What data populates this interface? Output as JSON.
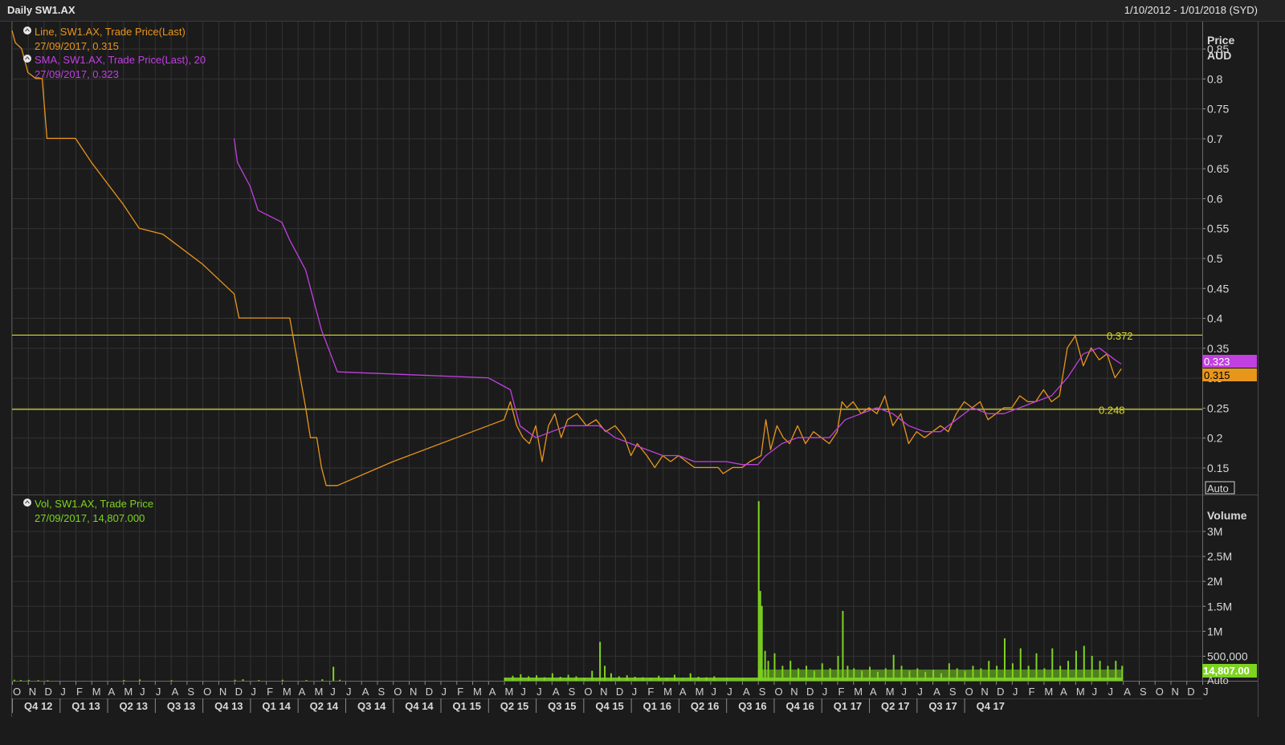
{
  "header": {
    "title": "Daily SW1.AX",
    "range": "1/10/2012 - 1/01/2018 (SYD)"
  },
  "colors": {
    "price": "#e8951c",
    "sma": "#c040e0",
    "volume": "#7ed321",
    "hline": "#d9d92a",
    "grid": "#333333",
    "text": "#d8d8d8",
    "bg": "#1b1b1b"
  },
  "chart_data": [
    {
      "type": "line",
      "panel": "price",
      "legend": [
        {
          "title": "Line, SW1.AX, Trade Price(Last)",
          "value": "27/09/2017, 0.315"
        },
        {
          "title": "SMA, SW1.AX, Trade Price(Last),  20",
          "value": "27/09/2017, 0.323"
        }
      ],
      "axis_title": [
        "Price",
        "AUD"
      ],
      "yticks": [
        "0.15",
        "0.2",
        "0.25",
        "0.3",
        "0.35",
        "0.4",
        "0.45",
        "0.5",
        "0.55",
        "0.6",
        "0.65",
        "0.7",
        "0.75",
        "0.8",
        "0.85"
      ],
      "ylim": [
        0.105,
        0.895
      ],
      "x_range_months": [
        0,
        75
      ],
      "series": [
        {
          "name": "Line, SW1.AX, Trade Price(Last)",
          "points": [
            [
              0,
              0.88
            ],
            [
              0.2,
              0.86
            ],
            [
              0.6,
              0.85
            ],
            [
              1.0,
              0.81
            ],
            [
              1.5,
              0.8
            ],
            [
              1.9,
              0.8
            ],
            [
              2.2,
              0.7
            ],
            [
              4.0,
              0.7
            ],
            [
              5.0,
              0.66
            ],
            [
              7.0,
              0.59
            ],
            [
              8.0,
              0.55
            ],
            [
              9.5,
              0.54
            ],
            [
              12.0,
              0.49
            ],
            [
              14.0,
              0.44
            ],
            [
              14.3,
              0.4
            ],
            [
              17.5,
              0.4
            ],
            [
              18.5,
              0.25
            ],
            [
              18.8,
              0.2
            ],
            [
              19.2,
              0.2
            ],
            [
              19.5,
              0.15
            ],
            [
              19.8,
              0.12
            ],
            [
              20.5,
              0.12
            ],
            [
              24.0,
              0.16
            ],
            [
              28.0,
              0.2
            ],
            [
              31.0,
              0.23
            ],
            [
              31.4,
              0.26
            ],
            [
              31.8,
              0.22
            ],
            [
              32.2,
              0.2
            ],
            [
              32.6,
              0.19
            ],
            [
              33.0,
              0.22
            ],
            [
              33.4,
              0.16
            ],
            [
              33.8,
              0.22
            ],
            [
              34.2,
              0.24
            ],
            [
              34.6,
              0.2
            ],
            [
              35.0,
              0.23
            ],
            [
              35.6,
              0.24
            ],
            [
              36.2,
              0.22
            ],
            [
              36.8,
              0.23
            ],
            [
              37.4,
              0.21
            ],
            [
              38.0,
              0.22
            ],
            [
              38.6,
              0.2
            ],
            [
              39.0,
              0.17
            ],
            [
              39.4,
              0.19
            ],
            [
              40.0,
              0.17
            ],
            [
              40.5,
              0.15
            ],
            [
              41.0,
              0.17
            ],
            [
              41.5,
              0.16
            ],
            [
              42.0,
              0.17
            ],
            [
              42.5,
              0.16
            ],
            [
              43.0,
              0.15
            ],
            [
              43.5,
              0.15
            ],
            [
              44.0,
              0.15
            ],
            [
              44.5,
              0.15
            ],
            [
              44.8,
              0.14
            ],
            [
              45.4,
              0.15
            ],
            [
              46.0,
              0.15
            ],
            [
              46.5,
              0.16
            ],
            [
              47.2,
              0.17
            ],
            [
              47.5,
              0.23
            ],
            [
              47.8,
              0.18
            ],
            [
              48.2,
              0.22
            ],
            [
              48.6,
              0.2
            ],
            [
              49.0,
              0.19
            ],
            [
              49.5,
              0.22
            ],
            [
              50.0,
              0.19
            ],
            [
              50.5,
              0.21
            ],
            [
              51.0,
              0.2
            ],
            [
              51.5,
              0.19
            ],
            [
              52.0,
              0.21
            ],
            [
              52.3,
              0.26
            ],
            [
              52.6,
              0.25
            ],
            [
              53.0,
              0.26
            ],
            [
              53.5,
              0.24
            ],
            [
              54.0,
              0.25
            ],
            [
              54.5,
              0.24
            ],
            [
              55.0,
              0.27
            ],
            [
              55.5,
              0.22
            ],
            [
              56.0,
              0.24
            ],
            [
              56.5,
              0.19
            ],
            [
              57.0,
              0.21
            ],
            [
              57.5,
              0.2
            ],
            [
              58.0,
              0.21
            ],
            [
              58.5,
              0.22
            ],
            [
              59.0,
              0.21
            ],
            [
              59.5,
              0.24
            ],
            [
              60.0,
              0.26
            ],
            [
              60.5,
              0.25
            ],
            [
              61.0,
              0.26
            ],
            [
              61.5,
              0.23
            ],
            [
              62.0,
              0.24
            ],
            [
              62.5,
              0.25
            ],
            [
              63.0,
              0.25
            ],
            [
              63.5,
              0.27
            ],
            [
              64.0,
              0.26
            ],
            [
              64.5,
              0.26
            ],
            [
              65.0,
              0.28
            ],
            [
              65.5,
              0.26
            ],
            [
              66.0,
              0.27
            ],
            [
              66.5,
              0.35
            ],
            [
              67.0,
              0.37
            ],
            [
              67.5,
              0.32
            ],
            [
              68.0,
              0.35
            ],
            [
              68.5,
              0.33
            ],
            [
              69.0,
              0.34
            ],
            [
              69.5,
              0.3
            ],
            [
              69.9,
              0.315
            ]
          ]
        },
        {
          "name": "SMA, SW1.AX, Trade Price(Last),  20",
          "points": [
            [
              14.0,
              0.7
            ],
            [
              14.2,
              0.66
            ],
            [
              15.0,
              0.62
            ],
            [
              15.5,
              0.58
            ],
            [
              17.0,
              0.56
            ],
            [
              17.5,
              0.53
            ],
            [
              18.5,
              0.48
            ],
            [
              19.0,
              0.43
            ],
            [
              19.5,
              0.38
            ],
            [
              20.5,
              0.31
            ],
            [
              30.0,
              0.3
            ],
            [
              31.4,
              0.28
            ],
            [
              32.0,
              0.22
            ],
            [
              33.0,
              0.2
            ],
            [
              34.0,
              0.21
            ],
            [
              35.0,
              0.22
            ],
            [
              36.0,
              0.22
            ],
            [
              37.0,
              0.22
            ],
            [
              38.0,
              0.2
            ],
            [
              39.0,
              0.19
            ],
            [
              40.0,
              0.18
            ],
            [
              41.0,
              0.17
            ],
            [
              42.0,
              0.17
            ],
            [
              43.0,
              0.16
            ],
            [
              44.0,
              0.16
            ],
            [
              45.0,
              0.16
            ],
            [
              46.0,
              0.155
            ],
            [
              47.0,
              0.155
            ],
            [
              47.5,
              0.17
            ],
            [
              48.5,
              0.19
            ],
            [
              49.5,
              0.2
            ],
            [
              50.5,
              0.2
            ],
            [
              51.5,
              0.2
            ],
            [
              52.5,
              0.23
            ],
            [
              53.5,
              0.24
            ],
            [
              54.5,
              0.25
            ],
            [
              55.5,
              0.24
            ],
            [
              56.5,
              0.22
            ],
            [
              57.5,
              0.21
            ],
            [
              58.5,
              0.21
            ],
            [
              59.5,
              0.23
            ],
            [
              60.5,
              0.25
            ],
            [
              61.5,
              0.24
            ],
            [
              62.5,
              0.24
            ],
            [
              63.5,
              0.25
            ],
            [
              64.5,
              0.26
            ],
            [
              65.5,
              0.27
            ],
            [
              66.5,
              0.3
            ],
            [
              67.5,
              0.34
            ],
            [
              68.5,
              0.35
            ],
            [
              69.5,
              0.33
            ],
            [
              69.9,
              0.323
            ]
          ]
        }
      ],
      "hlines": [
        {
          "value": 0.372,
          "label": "0.372"
        },
        {
          "value": 0.248,
          "label": "0.248"
        }
      ],
      "last_value_tags": [
        {
          "value": 0.323,
          "label": "0.323",
          "series": "SMA"
        },
        {
          "value": 0.315,
          "label": "0.315",
          "series": "Line"
        }
      ],
      "auto_label": "Auto"
    },
    {
      "type": "bar",
      "panel": "volume",
      "legend": [
        {
          "title": "Vol, SW1.AX, Trade Price",
          "value": "27/09/2017, 14,807.000"
        }
      ],
      "axis_title": "Volume",
      "yticks": [
        "500,000",
        "1M",
        "1.5M",
        "2M",
        "2.5M",
        "3M"
      ],
      "ylim": [
        0,
        3700000
      ],
      "last_value_tag": "14,807.00",
      "auto_label": "Auto",
      "bars": [
        [
          0.1,
          20000
        ],
        [
          0.5,
          15000
        ],
        [
          1.0,
          18000
        ],
        [
          1.6,
          12000
        ],
        [
          2.2,
          10000
        ],
        [
          7.0,
          15000
        ],
        [
          8.0,
          25000
        ],
        [
          10.0,
          12000
        ],
        [
          14.0,
          20000
        ],
        [
          14.5,
          30000
        ],
        [
          15.5,
          15000
        ],
        [
          17.0,
          20000
        ],
        [
          18.5,
          15000
        ],
        [
          19.5,
          30000
        ],
        [
          20.2,
          280000
        ],
        [
          20.6,
          20000
        ],
        [
          31.0,
          60000
        ],
        [
          31.5,
          100000
        ],
        [
          32.0,
          130000
        ],
        [
          32.5,
          90000
        ],
        [
          33.0,
          110000
        ],
        [
          33.5,
          70000
        ],
        [
          34.0,
          150000
        ],
        [
          34.5,
          80000
        ],
        [
          35.0,
          120000
        ],
        [
          35.5,
          90000
        ],
        [
          36.0,
          60000
        ],
        [
          36.5,
          200000
        ],
        [
          37.0,
          780000
        ],
        [
          37.3,
          300000
        ],
        [
          37.7,
          150000
        ],
        [
          38.2,
          90000
        ],
        [
          38.7,
          110000
        ],
        [
          39.2,
          80000
        ],
        [
          39.7,
          70000
        ],
        [
          40.2,
          60000
        ],
        [
          40.7,
          100000
        ],
        [
          41.2,
          50000
        ],
        [
          41.7,
          120000
        ],
        [
          42.2,
          40000
        ],
        [
          42.7,
          150000
        ],
        [
          43.2,
          80000
        ],
        [
          43.7,
          70000
        ],
        [
          44.2,
          90000
        ],
        [
          45.0,
          50000
        ],
        [
          46.0,
          40000
        ],
        [
          47.0,
          3600000
        ],
        [
          47.1,
          1800000
        ],
        [
          47.2,
          1500000
        ],
        [
          47.4,
          600000
        ],
        [
          47.6,
          400000
        ],
        [
          48.0,
          550000
        ],
        [
          48.5,
          300000
        ],
        [
          49.0,
          400000
        ],
        [
          49.5,
          250000
        ],
        [
          50.0,
          300000
        ],
        [
          50.5,
          200000
        ],
        [
          51.0,
          350000
        ],
        [
          51.5,
          250000
        ],
        [
          52.0,
          500000
        ],
        [
          52.3,
          1400000
        ],
        [
          52.6,
          300000
        ],
        [
          53.0,
          250000
        ],
        [
          53.5,
          200000
        ],
        [
          54.0,
          280000
        ],
        [
          54.5,
          180000
        ],
        [
          55.0,
          250000
        ],
        [
          55.5,
          520000
        ],
        [
          56.0,
          300000
        ],
        [
          56.5,
          200000
        ],
        [
          57.0,
          250000
        ],
        [
          57.5,
          180000
        ],
        [
          58.0,
          220000
        ],
        [
          58.5,
          150000
        ],
        [
          59.0,
          350000
        ],
        [
          59.5,
          250000
        ],
        [
          60.0,
          200000
        ],
        [
          60.5,
          300000
        ],
        [
          61.0,
          250000
        ],
        [
          61.5,
          400000
        ],
        [
          62.0,
          300000
        ],
        [
          62.5,
          850000
        ],
        [
          63.0,
          350000
        ],
        [
          63.5,
          650000
        ],
        [
          64.0,
          300000
        ],
        [
          64.5,
          550000
        ],
        [
          65.0,
          250000
        ],
        [
          65.5,
          650000
        ],
        [
          66.0,
          300000
        ],
        [
          66.5,
          400000
        ],
        [
          67.0,
          600000
        ],
        [
          67.5,
          700000
        ],
        [
          68.0,
          500000
        ],
        [
          68.5,
          400000
        ],
        [
          69.0,
          300000
        ],
        [
          69.5,
          400000
        ],
        [
          69.9,
          300000
        ]
      ]
    }
  ],
  "x_axis": {
    "months": [
      "O",
      "N",
      "D",
      "J",
      "F",
      "M",
      "A",
      "M",
      "J",
      "J",
      "A",
      "S",
      "O",
      "N",
      "D",
      "J",
      "F",
      "M",
      "A",
      "M",
      "J",
      "J",
      "A",
      "S",
      "O",
      "N",
      "D",
      "J",
      "F",
      "M",
      "A",
      "M",
      "J",
      "J",
      "A",
      "S",
      "O",
      "N",
      "D",
      "J",
      "F",
      "M",
      "A",
      "M",
      "J",
      "J",
      "A",
      "S",
      "O",
      "N",
      "D",
      "J",
      "F",
      "M",
      "A",
      "M",
      "J",
      "J",
      "A",
      "S",
      "O",
      "N",
      "D",
      "J",
      "F",
      "M",
      "A",
      "M",
      "J",
      "J",
      "A",
      "S",
      "O",
      "N",
      "D",
      "J"
    ],
    "quarters": [
      "Q4 12",
      "Q1 13",
      "Q2 13",
      "Q3 13",
      "Q4 13",
      "Q1 14",
      "Q2 14",
      "Q3 14",
      "Q4 14",
      "Q1 15",
      "Q2 15",
      "Q3 15",
      "Q4 15",
      "Q1 16",
      "Q2 16",
      "Q3 16",
      "Q4 16",
      "Q1 17",
      "Q2 17",
      "Q3 17",
      "Q4 17"
    ]
  }
}
